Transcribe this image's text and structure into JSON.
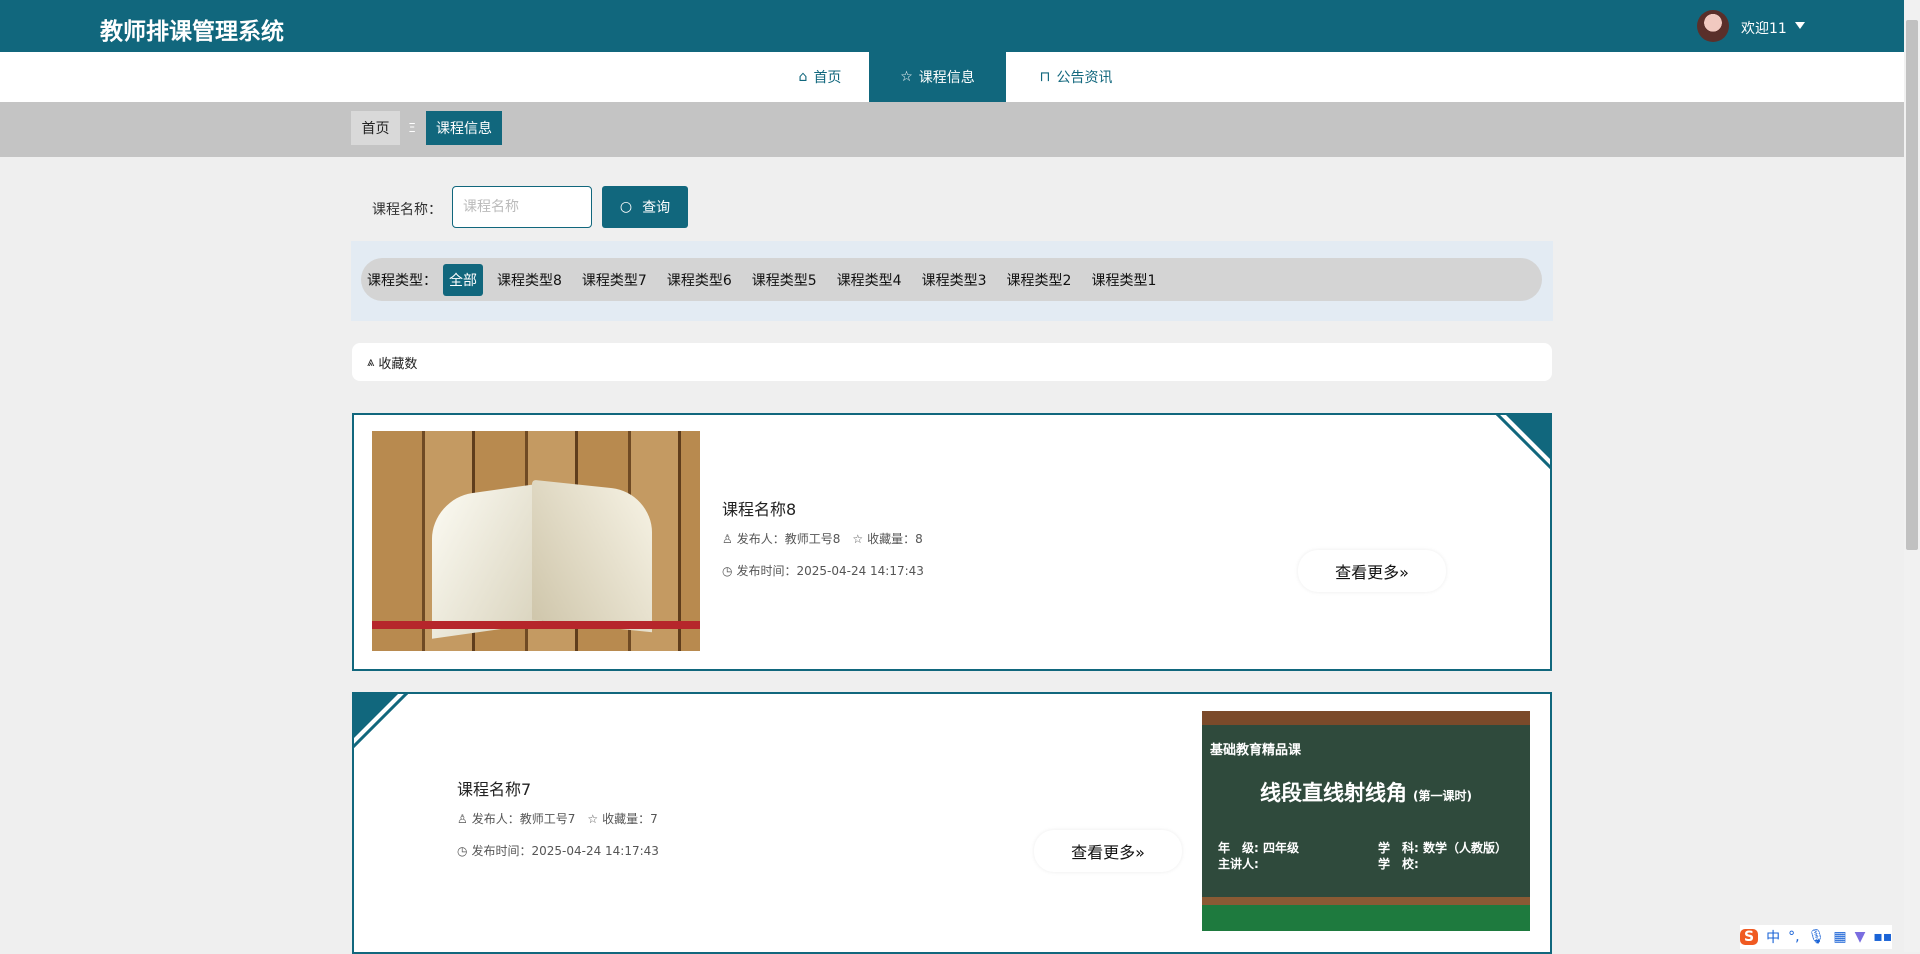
{
  "header": {
    "title": "教师排课管理系统",
    "welcome": "欢迎11"
  },
  "nav": [
    {
      "label": "首页",
      "icon": "home-icon"
    },
    {
      "label": "课程信息",
      "icon": "star-icon"
    },
    {
      "label": "公告资讯",
      "icon": "bag-icon"
    }
  ],
  "breadcrumb": {
    "home": "首页",
    "sep": "Ξ",
    "current": "课程信息"
  },
  "search": {
    "label": "课程名称：",
    "placeholder": "课程名称",
    "button": "查询"
  },
  "filter": {
    "label": "课程类型：",
    "items": [
      "全部",
      "课程类型8",
      "课程类型7",
      "课程类型6",
      "课程类型5",
      "课程类型4",
      "课程类型3",
      "课程类型2",
      "课程类型1"
    ]
  },
  "sort": {
    "label": "收藏数"
  },
  "courses": [
    {
      "title": "课程名称8",
      "publisher": "发布人：教师工号8",
      "favorites": "收藏量：8",
      "time": "发布时间：2025-04-24 14:17:43",
      "more": "查看更多»"
    },
    {
      "title": "课程名称7",
      "publisher": "发布人：教师工号7",
      "favorites": "收藏量：7",
      "time": "发布时间：2025-04-24 14:17:43",
      "more": "查看更多»",
      "image_text": {
        "series": "基础教育精品课",
        "lesson": "线段直线射线角",
        "part": "(第一课时)",
        "grade": "年　级: 四年级",
        "subject": "学　科: 数学（人教版）",
        "teacher": "主讲人:",
        "school": "学　校:"
      }
    }
  ],
  "ime": {
    "mode": "中",
    "punct": "°,"
  }
}
